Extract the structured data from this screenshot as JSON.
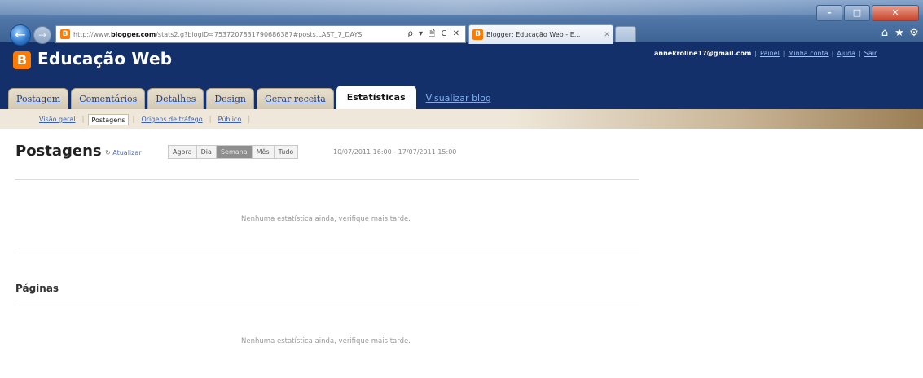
{
  "browser": {
    "url_prefix": "http://www.",
    "url_domain": "blogger.com",
    "url_rest": "/stats2.g?blogID=7537207831790686387#posts,LAST_7_DAYS",
    "address_tools": "ρ ▾ 🗎 C ✕",
    "tab_title": "Blogger: Educação Web - E...",
    "tab_close": "✕",
    "back_glyph": "←",
    "forward_glyph": "→",
    "window_minimize": "–",
    "window_maximize": "□",
    "window_close": "✕",
    "home_icon_glyph": "⌂",
    "favorites_icon_glyph": "★",
    "tools_icon_glyph": "⚙",
    "favicon_letter": "B"
  },
  "header": {
    "logo_letter": "B",
    "blog_title": "Educação Web",
    "user_email": "annekroline17@gmail.com",
    "links": [
      "Painel",
      "Minha conta",
      "Ajuda",
      "Sair"
    ]
  },
  "main_tabs": [
    {
      "label": "Postagem",
      "active": false
    },
    {
      "label": "Comentários",
      "active": false
    },
    {
      "label": "Detalhes",
      "active": false
    },
    {
      "label": "Design",
      "active": false
    },
    {
      "label": "Gerar receita",
      "active": false
    },
    {
      "label": "Estatísticas",
      "active": true
    }
  ],
  "view_blog_label": "Visualizar blog",
  "sub_tabs": [
    {
      "label": "Visão geral",
      "active": false
    },
    {
      "label": "Postagens",
      "active": true
    },
    {
      "label": "Origens de tráfego",
      "active": false
    },
    {
      "label": "Público",
      "active": false
    }
  ],
  "stats": {
    "title": "Postagens",
    "refresh_icon": "↻",
    "refresh_label": "Atualizar",
    "ranges": [
      {
        "label": "Agora",
        "active": false
      },
      {
        "label": "Dia",
        "active": false
      },
      {
        "label": "Semana",
        "active": true
      },
      {
        "label": "Mês",
        "active": false
      },
      {
        "label": "Tudo",
        "active": false
      }
    ],
    "date_range": "10/07/2011 16:00 - 17/07/2011 15:00",
    "posts_empty": "Nenhuma estatística ainda, verifique mais tarde.",
    "pages_title": "Páginas",
    "pages_empty": "Nenhuma estatística ainda, verifique mais tarde."
  }
}
